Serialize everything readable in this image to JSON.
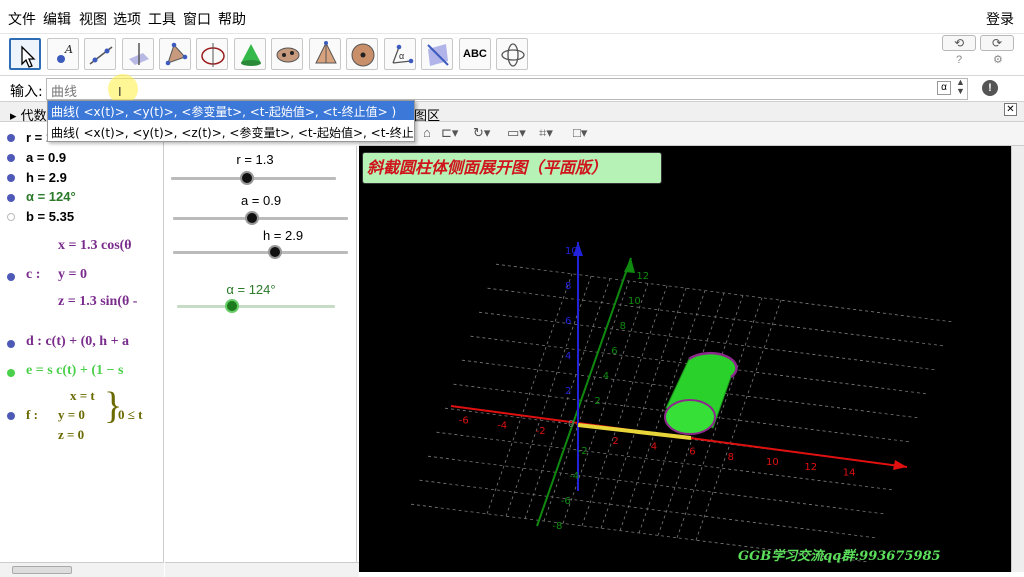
{
  "menu": {
    "items": [
      "文件",
      "编辑",
      "视图",
      "选项",
      "工具",
      "窗口",
      "帮助"
    ],
    "login": "登录"
  },
  "toolbar": {
    "tools": [
      "move-tool",
      "point-tool",
      "line-tool",
      "perpendicular-tool",
      "polygon-tool",
      "circle-tool",
      "sphere-tool",
      "conic-tool",
      "pyramid-tool",
      "sphere-point-tool",
      "angle-tool",
      "reflect-tool",
      "text-tool",
      "rotate-view-tool"
    ],
    "text_tool_label": "ABC",
    "undo": "⟲",
    "redo": "⟳"
  },
  "input": {
    "label": "输入:",
    "value": "曲线",
    "alpha": "α"
  },
  "suggestions": [
    "曲线( <x(t)>, <y(t)>, <参变量t>, <t-起始值>, <t-终止值> )",
    "曲线( <x(t)>, <y(t)>, <z(t)>, <参变量t>, <t-起始值>, <t-终止值> )"
  ],
  "panels": {
    "algebra_title": "代数",
    "graphics3d_title": "图区"
  },
  "algebra": {
    "r": "r = 1.3",
    "a": "a = 0.9",
    "h": "h = 2.9",
    "alpha": "α = 124°",
    "b": "b = 5.35",
    "c_label": "c :",
    "c_x": "x = 1.3 cos(θ",
    "c_y": "y = 0",
    "c_z": "z = 1.3 sin(θ -",
    "d": "d : c(t) + (0, h + a",
    "e": "e = s c(t) + (1 − s",
    "f_label": "f :",
    "f_x": "x = t",
    "f_y": "y = 0",
    "f_z": "z = 0",
    "f_range": "0 ≤ t"
  },
  "sliders": {
    "r": {
      "label": "r = 1.3",
      "value": 0.46
    },
    "a": {
      "label": "a = 0.9",
      "value": 0.45
    },
    "h": {
      "label": "h = 2.9",
      "value": 0.58
    },
    "alpha": {
      "label": "α = 124°",
      "value": 0.35
    }
  },
  "colors": {
    "accent": "#3c78d8",
    "alpha_green": "#2a7a2a",
    "e_green": "#4bd04b",
    "purple": "#7a2c8c",
    "olive": "#6a6a00"
  },
  "view3d": {
    "banner": "斜截圆柱体侧面展开图（平面版）",
    "watermark": "GGB学习交流qq群:993675985",
    "x_ticks": [
      "-6",
      "-4",
      "-2",
      "2",
      "4",
      "6",
      "8",
      "10",
      "12",
      "14"
    ],
    "y_ticks": [
      "12",
      "10",
      "8",
      "6",
      "4",
      "2",
      "-2",
      "-4",
      "-6",
      "-8"
    ],
    "z_ticks": [
      "10",
      "8",
      "6",
      "4",
      "2"
    ],
    "origin": "0"
  }
}
